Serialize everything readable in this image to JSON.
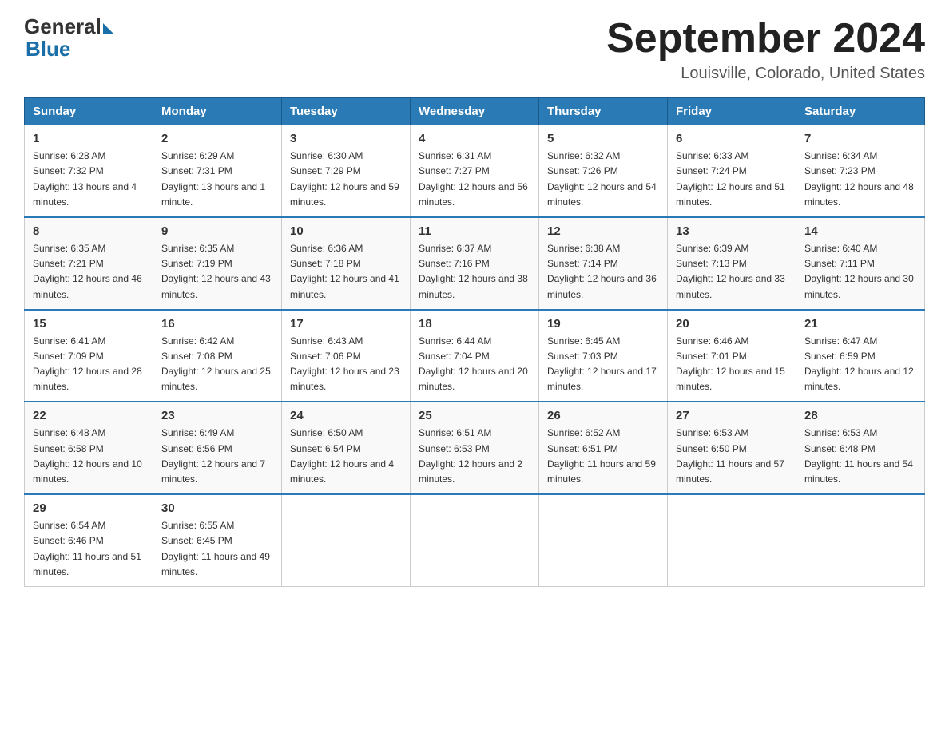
{
  "header": {
    "logo_line1": "General",
    "logo_line2": "Blue",
    "title": "September 2024",
    "subtitle": "Louisville, Colorado, United States"
  },
  "days_of_week": [
    "Sunday",
    "Monday",
    "Tuesday",
    "Wednesday",
    "Thursday",
    "Friday",
    "Saturday"
  ],
  "weeks": [
    [
      {
        "day": "1",
        "sunrise": "6:28 AM",
        "sunset": "7:32 PM",
        "daylight": "13 hours and 4 minutes."
      },
      {
        "day": "2",
        "sunrise": "6:29 AM",
        "sunset": "7:31 PM",
        "daylight": "13 hours and 1 minute."
      },
      {
        "day": "3",
        "sunrise": "6:30 AM",
        "sunset": "7:29 PM",
        "daylight": "12 hours and 59 minutes."
      },
      {
        "day": "4",
        "sunrise": "6:31 AM",
        "sunset": "7:27 PM",
        "daylight": "12 hours and 56 minutes."
      },
      {
        "day": "5",
        "sunrise": "6:32 AM",
        "sunset": "7:26 PM",
        "daylight": "12 hours and 54 minutes."
      },
      {
        "day": "6",
        "sunrise": "6:33 AM",
        "sunset": "7:24 PM",
        "daylight": "12 hours and 51 minutes."
      },
      {
        "day": "7",
        "sunrise": "6:34 AM",
        "sunset": "7:23 PM",
        "daylight": "12 hours and 48 minutes."
      }
    ],
    [
      {
        "day": "8",
        "sunrise": "6:35 AM",
        "sunset": "7:21 PM",
        "daylight": "12 hours and 46 minutes."
      },
      {
        "day": "9",
        "sunrise": "6:35 AM",
        "sunset": "7:19 PM",
        "daylight": "12 hours and 43 minutes."
      },
      {
        "day": "10",
        "sunrise": "6:36 AM",
        "sunset": "7:18 PM",
        "daylight": "12 hours and 41 minutes."
      },
      {
        "day": "11",
        "sunrise": "6:37 AM",
        "sunset": "7:16 PM",
        "daylight": "12 hours and 38 minutes."
      },
      {
        "day": "12",
        "sunrise": "6:38 AM",
        "sunset": "7:14 PM",
        "daylight": "12 hours and 36 minutes."
      },
      {
        "day": "13",
        "sunrise": "6:39 AM",
        "sunset": "7:13 PM",
        "daylight": "12 hours and 33 minutes."
      },
      {
        "day": "14",
        "sunrise": "6:40 AM",
        "sunset": "7:11 PM",
        "daylight": "12 hours and 30 minutes."
      }
    ],
    [
      {
        "day": "15",
        "sunrise": "6:41 AM",
        "sunset": "7:09 PM",
        "daylight": "12 hours and 28 minutes."
      },
      {
        "day": "16",
        "sunrise": "6:42 AM",
        "sunset": "7:08 PM",
        "daylight": "12 hours and 25 minutes."
      },
      {
        "day": "17",
        "sunrise": "6:43 AM",
        "sunset": "7:06 PM",
        "daylight": "12 hours and 23 minutes."
      },
      {
        "day": "18",
        "sunrise": "6:44 AM",
        "sunset": "7:04 PM",
        "daylight": "12 hours and 20 minutes."
      },
      {
        "day": "19",
        "sunrise": "6:45 AM",
        "sunset": "7:03 PM",
        "daylight": "12 hours and 17 minutes."
      },
      {
        "day": "20",
        "sunrise": "6:46 AM",
        "sunset": "7:01 PM",
        "daylight": "12 hours and 15 minutes."
      },
      {
        "day": "21",
        "sunrise": "6:47 AM",
        "sunset": "6:59 PM",
        "daylight": "12 hours and 12 minutes."
      }
    ],
    [
      {
        "day": "22",
        "sunrise": "6:48 AM",
        "sunset": "6:58 PM",
        "daylight": "12 hours and 10 minutes."
      },
      {
        "day": "23",
        "sunrise": "6:49 AM",
        "sunset": "6:56 PM",
        "daylight": "12 hours and 7 minutes."
      },
      {
        "day": "24",
        "sunrise": "6:50 AM",
        "sunset": "6:54 PM",
        "daylight": "12 hours and 4 minutes."
      },
      {
        "day": "25",
        "sunrise": "6:51 AM",
        "sunset": "6:53 PM",
        "daylight": "12 hours and 2 minutes."
      },
      {
        "day": "26",
        "sunrise": "6:52 AM",
        "sunset": "6:51 PM",
        "daylight": "11 hours and 59 minutes."
      },
      {
        "day": "27",
        "sunrise": "6:53 AM",
        "sunset": "6:50 PM",
        "daylight": "11 hours and 57 minutes."
      },
      {
        "day": "28",
        "sunrise": "6:53 AM",
        "sunset": "6:48 PM",
        "daylight": "11 hours and 54 minutes."
      }
    ],
    [
      {
        "day": "29",
        "sunrise": "6:54 AM",
        "sunset": "6:46 PM",
        "daylight": "11 hours and 51 minutes."
      },
      {
        "day": "30",
        "sunrise": "6:55 AM",
        "sunset": "6:45 PM",
        "daylight": "11 hours and 49 minutes."
      },
      null,
      null,
      null,
      null,
      null
    ]
  ]
}
